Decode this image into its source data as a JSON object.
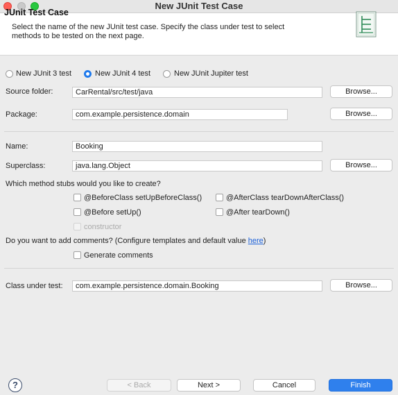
{
  "window": {
    "title": "New JUnit Test Case"
  },
  "header": {
    "title": "JUnit Test Case",
    "description": "Select the name of the new JUnit test case. Specify the class under test to select methods to be tested on the next page.",
    "icon": "junit-wizard-icon"
  },
  "junit_versions": [
    {
      "label": "New JUnit 3 test",
      "selected": false
    },
    {
      "label": "New JUnit 4 test",
      "selected": true
    },
    {
      "label": "New JUnit Jupiter test",
      "selected": false
    }
  ],
  "source_folder": {
    "label": "Source folder:",
    "value": "CarRental/src/test/java",
    "browse": "Browse..."
  },
  "package": {
    "label": "Package:",
    "value": "com.example.persistence.domain",
    "browse": "Browse..."
  },
  "name": {
    "label": "Name:",
    "value": "Booking"
  },
  "superclass": {
    "label": "Superclass:",
    "value": "java.lang.Object",
    "browse": "Browse..."
  },
  "stubs": {
    "question": "Which method stubs would you like to create?",
    "before_class": "@BeforeClass setUpBeforeClass()",
    "after_class": "@AfterClass tearDownAfterClass()",
    "before": "@Before setUp()",
    "after": "@After tearDown()",
    "constructor": "constructor"
  },
  "comments": {
    "question_prefix": "Do you want to add comments? (Configure templates and default value ",
    "link": "here",
    "question_suffix": ")",
    "generate": "Generate comments"
  },
  "class_under_test": {
    "label": "Class under test:",
    "value": "com.example.persistence.domain.Booking",
    "browse": "Browse..."
  },
  "footer": {
    "help": "?",
    "back": "< Back",
    "next": "Next >",
    "cancel": "Cancel",
    "finish": "Finish"
  }
}
